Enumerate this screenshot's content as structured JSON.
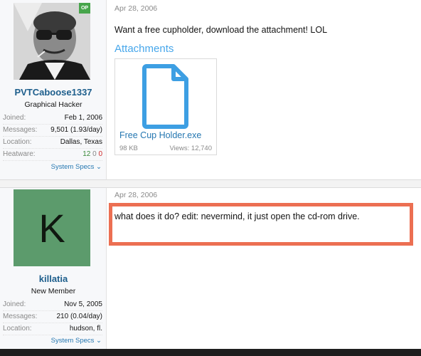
{
  "posts": [
    {
      "username": "PVTCaboose1337",
      "user_title": "Graphical Hacker",
      "op_badge": "OP",
      "avatar_icon": "user-photo-avatar",
      "joined_label": "Joined:",
      "joined": "Feb 1, 2006",
      "messages_label": "Messages:",
      "messages": "9,501 (1.93/day)",
      "location_label": "Location:",
      "location": "Dallas, Texas",
      "heatware_label": "Heatware:",
      "heatware": [
        "12",
        "0",
        "0"
      ],
      "system_specs": "System Specs",
      "date": "Apr 28, 2006",
      "message": "Want a free cupholder, download the attachment! LOL",
      "attachments_title": "Attachments",
      "attachment": {
        "icon": "file-icon",
        "name": "Free Cup Holder.exe",
        "size": "98 KB",
        "views": "Views: 12,740"
      }
    },
    {
      "username": "killatia",
      "user_title": "New Member",
      "avatar_letter": "K",
      "joined_label": "Joined:",
      "joined": "Nov 5, 2005",
      "messages_label": "Messages:",
      "messages": "210 (0.04/day)",
      "location_label": "Location:",
      "location": "hudson, fl.",
      "system_specs": "System Specs",
      "date": "Apr 28, 2006",
      "message": "what does it do? edit: nevermind, it just open the cd-rom drive."
    }
  ],
  "colors": {
    "username": "#1d5e8c",
    "link": "#2577b1",
    "attachments_title": "#47a7eb",
    "highlight": "#ec6f52",
    "op_badge": "#47a54b",
    "avatar_letter_bg": "#5c9b6c"
  }
}
